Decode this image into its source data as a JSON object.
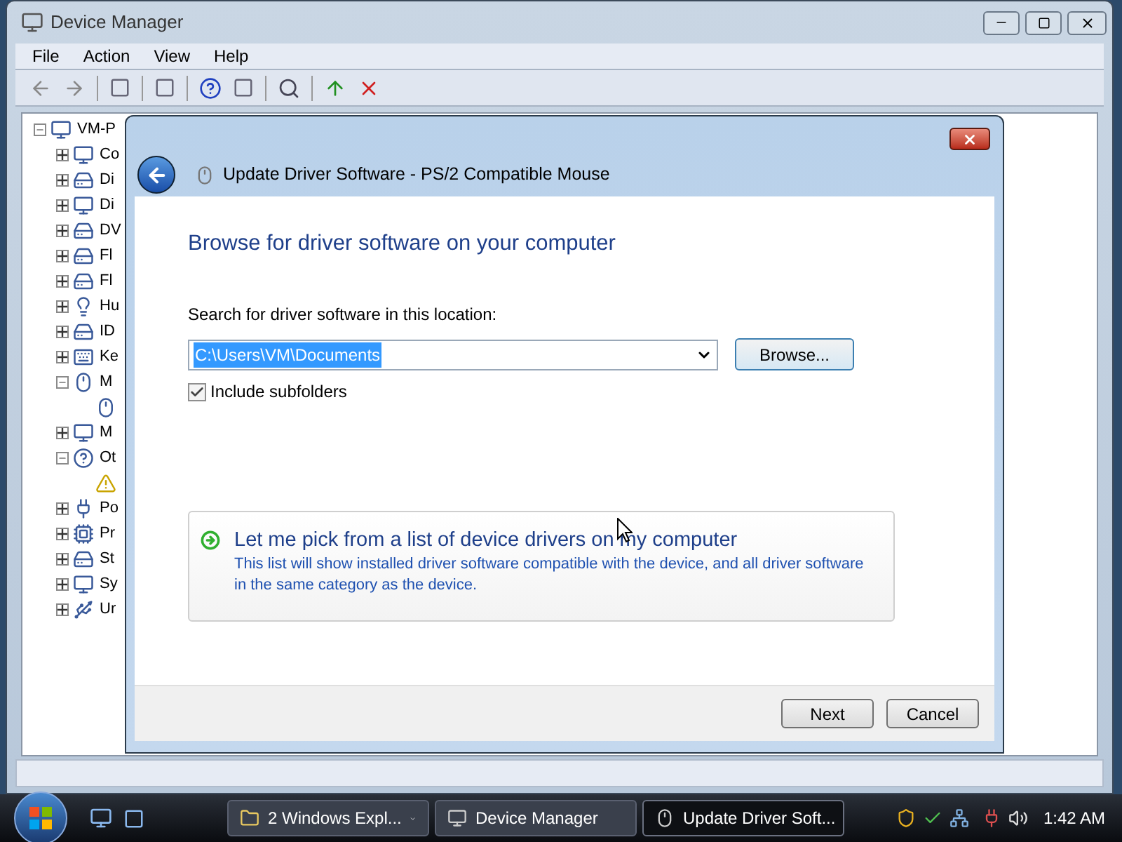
{
  "main_window": {
    "title": "Device Manager",
    "menu": [
      "File",
      "Action",
      "View",
      "Help"
    ],
    "tree": [
      {
        "label": "VM-P",
        "kind": "computer",
        "expanded": true,
        "children": [
          {
            "label": "Co",
            "kind": "computer",
            "expanded": false
          },
          {
            "label": "Di",
            "kind": "drive",
            "expanded": false
          },
          {
            "label": "Di",
            "kind": "display",
            "expanded": false
          },
          {
            "label": "DV",
            "kind": "drive",
            "expanded": false
          },
          {
            "label": "Fl",
            "kind": "drive",
            "expanded": false
          },
          {
            "label": "Fl",
            "kind": "drive",
            "expanded": false
          },
          {
            "label": "Hu",
            "kind": "hid",
            "expanded": false
          },
          {
            "label": "ID",
            "kind": "drive",
            "expanded": false
          },
          {
            "label": "Ke",
            "kind": "keyboard",
            "expanded": false
          },
          {
            "label": "M",
            "kind": "mouse",
            "expanded": true,
            "children": [
              {
                "kind": "mouse"
              }
            ]
          },
          {
            "label": "M",
            "kind": "display",
            "expanded": false
          },
          {
            "label": "Ot",
            "kind": "unknown",
            "expanded": true,
            "children": [
              {
                "kind": "warning"
              }
            ]
          },
          {
            "label": "Po",
            "kind": "port",
            "expanded": false
          },
          {
            "label": "Pr",
            "kind": "chip",
            "expanded": false
          },
          {
            "label": "St",
            "kind": "storage",
            "expanded": false
          },
          {
            "label": "Sy",
            "kind": "computer",
            "expanded": false
          },
          {
            "label": "Ur",
            "kind": "usb",
            "expanded": false
          }
        ]
      }
    ]
  },
  "dialog": {
    "title": "Update Driver Software - PS/2 Compatible Mouse",
    "heading": "Browse for driver software on your computer",
    "location_label": "Search for driver software in this location:",
    "location_value": "C:\\Users\\VM\\Documents",
    "browse_button": "Browse...",
    "include_subfolders": {
      "label": "Include subfolders",
      "checked": true
    },
    "option": {
      "title": "Let me pick from a list of device drivers on my computer",
      "description": "This list will show installed driver software compatible with the device, and all driver software in the same category as the device."
    },
    "buttons": [
      "Next",
      "Cancel"
    ]
  },
  "taskbar": {
    "tasks": [
      {
        "label": "2 Windows Expl...",
        "kind": "folder",
        "selected": false
      },
      {
        "label": "Device Manager",
        "kind": "devmgr",
        "selected": false
      },
      {
        "label": "Update Driver Soft...",
        "kind": "driver",
        "selected": true
      }
    ],
    "clock": "1:42 AM"
  }
}
